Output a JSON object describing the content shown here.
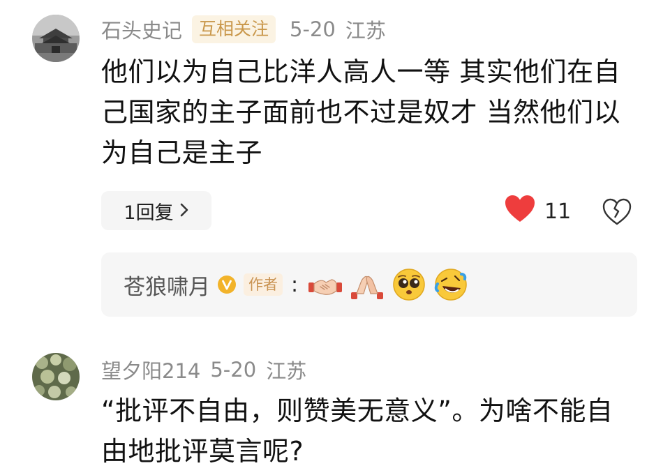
{
  "comments": [
    {
      "username": "石头史记",
      "badge": "互相关注",
      "date": "5-20",
      "location": "江苏",
      "text": "他们以为自己比洋人高人一等 其实他们在自己国家的主子面前也不过是奴才 当然他们以为自己是主子",
      "reply_count_label": "1回复",
      "likes": "11",
      "reply": {
        "username": "苍狼啸月",
        "author_tag": "作者",
        "separator": ":",
        "emojis": [
          "handshake-emoji",
          "clapping-hands-emoji",
          "pleading-face-emoji",
          "rolling-laughing-emoji"
        ]
      }
    },
    {
      "username": "望夕阳214",
      "date": "5-20",
      "location": "江苏",
      "text": "“批评不自由，则赞美无意义”。为啥不能自由地批评莫言呢?"
    }
  ],
  "colors": {
    "like_heart": "#ee3d3d",
    "badge_text": "#c9974a",
    "badge_bg": "#fbf3e3",
    "verified": "#f2b32a"
  }
}
